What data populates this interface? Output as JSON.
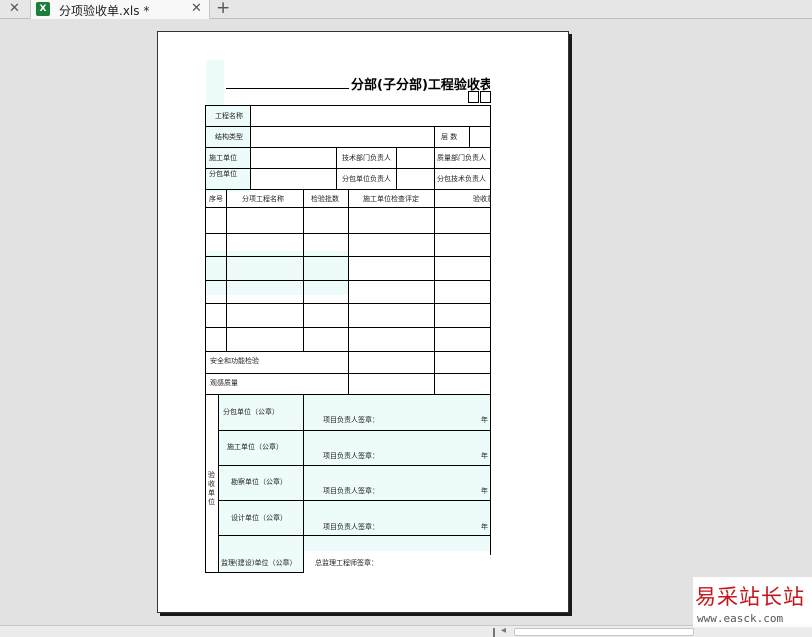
{
  "tabbar": {
    "close_glyph": "✕",
    "file_icon": "excel-icon",
    "file_icon_letter": "X",
    "tab_title": "分项验收单.xls *",
    "tab_close_glyph": "✕",
    "add_glyph": "+"
  },
  "form": {
    "title": "分部(子分部)工程验收表",
    "project_name": "工程名称",
    "structure_type": "结构类型",
    "floors": "层  数",
    "construction_unit": "施工单位",
    "tech_dept_head": "技术部门负责人",
    "quality_dept_head": "质量部门负责人",
    "sub_contractor": "分包单位",
    "sub_contractor_head": "分包单位负责人",
    "sub_contractor_tech_head": "分包技术负责人",
    "col_no": "序号",
    "col_item_name": "分项工程名称",
    "col_batch_count": "检验批数",
    "col_eval": "施工单位检查评定",
    "col_accept": "验收意见",
    "safety_check": "安全和功能检验",
    "visual_quality": "观感质量",
    "accept_unit_label": "验收单位",
    "units": [
      {
        "name": "分包单位（公章）",
        "signer": "项目负责人签章：",
        "year": "年"
      },
      {
        "name": "施工单位（公章）",
        "signer": "项目负责人签章：",
        "year": "年"
      },
      {
        "name": "勘察单位（公章）",
        "signer": "项目负责人签章：",
        "year": "年"
      },
      {
        "name": "设计单位（公章）",
        "signer": "项目负责人签章：",
        "year": "年"
      },
      {
        "name": "监理(建设)单位（公章）",
        "signer": "总监理工程师签章：",
        "year": ""
      }
    ]
  },
  "watermark": {
    "title": "易采站长站",
    "url": "www.easck.com"
  },
  "colors": {
    "cell_fill": "#eefbfb",
    "watermark_red": "#c4161c",
    "excel_green": "#1d7d3c"
  }
}
